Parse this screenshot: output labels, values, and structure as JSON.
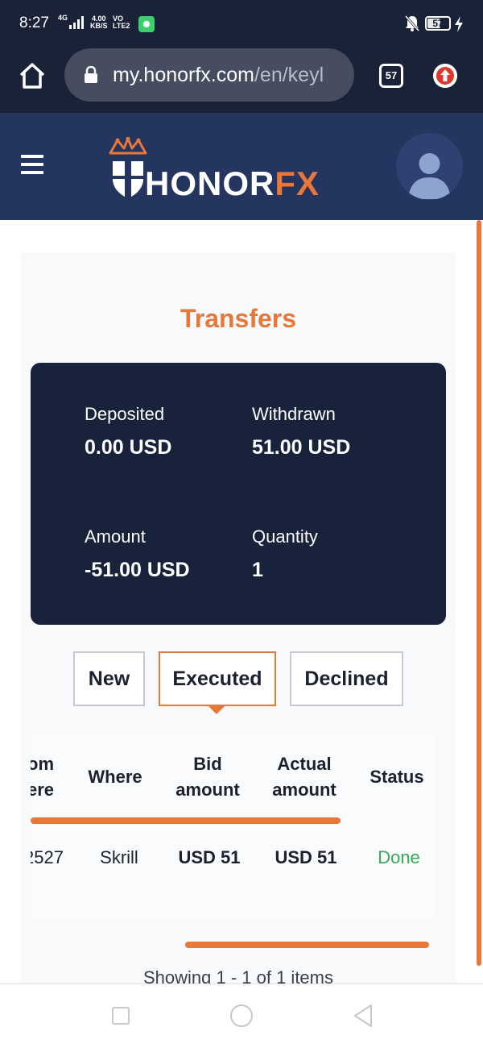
{
  "status_bar": {
    "time": "8:27",
    "network": "4G",
    "speed_value": "4.00",
    "speed_unit": "KB/S",
    "volte": "VO LTE2",
    "battery": "57",
    "icons": [
      "signal-icon",
      "app-notification-icon",
      "bell-off-icon",
      "battery-icon",
      "charging-icon"
    ]
  },
  "browser": {
    "url_host": "my.honorfx.com",
    "url_path": "/en/keyl",
    "tab_count": "57",
    "icons": [
      "home-icon",
      "lock-icon",
      "tabs-icon",
      "update-icon"
    ]
  },
  "site": {
    "logo_main": "HONOR",
    "logo_accent": "FX",
    "icons": [
      "menu-icon",
      "crown-shield-icon",
      "user-avatar-icon"
    ],
    "colors": {
      "header": "#24355f",
      "accent": "#e8773a",
      "summary": "#19223b"
    }
  },
  "page": {
    "title": "Transfers",
    "summary": {
      "deposited_label": "Deposited",
      "deposited_value": "0.00 USD",
      "withdrawn_label": "Withdrawn",
      "withdrawn_value": "51.00 USD",
      "amount_label": "Amount",
      "amount_value": "-51.00 USD",
      "quantity_label": "Quantity",
      "quantity_value": "1"
    },
    "tabs": [
      {
        "label": "New",
        "active": false
      },
      {
        "label": "Executed",
        "active": true
      },
      {
        "label": "Declined",
        "active": false
      }
    ],
    "table": {
      "headers": {
        "from_line1": "om",
        "from_line2": "ere",
        "where": "Where",
        "bid_line1": "Bid",
        "bid_line2": "amount",
        "actual_line1": "Actual",
        "actual_line2": "amount",
        "status": "Status"
      },
      "rows": [
        {
          "from": "2527",
          "where": "Skrill",
          "bid": "USD 51",
          "actual": "USD 51",
          "status": "Done"
        }
      ]
    },
    "pagination": "Showing 1 - 1 of 1 items"
  },
  "nav_bar": {
    "icons": [
      "recents-icon",
      "home-nav-icon",
      "back-icon"
    ]
  }
}
